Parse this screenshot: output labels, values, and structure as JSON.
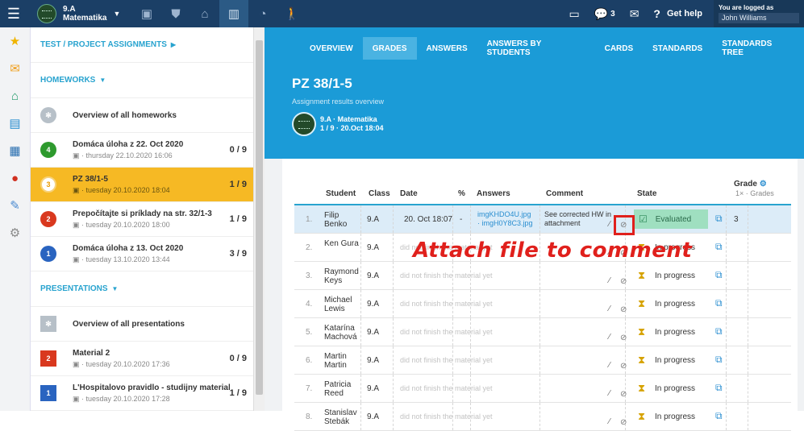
{
  "topbar": {
    "class_name": "9.A",
    "class_subject": "Matematika",
    "notifications_count": "3",
    "help_label": "Get help",
    "logged_as_label": "You are logged as",
    "user_name": "John Williams"
  },
  "left": {
    "assignments_title": "TEST / PROJECT ASSIGNMENTS",
    "homeworks_title": "HOMEWORKS",
    "homeworks": [
      {
        "badge": "",
        "title": "Overview of all homeworks",
        "sub": "",
        "score": ""
      },
      {
        "badge": "4",
        "title": "Domáca úloha z 22. Oct 2020",
        "sub": "thursday 22.10.2020 16:06",
        "score": "0 / 9"
      },
      {
        "badge": "3",
        "title": "PZ 38/1-5",
        "sub": "tuesday 20.10.2020 18:04",
        "score": "1 / 9"
      },
      {
        "badge": "2",
        "title": "Prepočítajte si príklady na str. 32/1-3",
        "sub": "tuesday 20.10.2020 18:00",
        "score": "1 / 9"
      },
      {
        "badge": "1",
        "title": "Domáca úloha z 13. Oct 2020",
        "sub": "tuesday 13.10.2020 13:44",
        "score": "3 / 9"
      }
    ],
    "presentations_title": "PRESENTATIONS",
    "presentations": [
      {
        "badge": "",
        "title": "Overview of all presentations",
        "sub": "",
        "score": ""
      },
      {
        "badge": "2",
        "title": "Material 2",
        "sub": "tuesday 20.10.2020 17:36",
        "score": "0 / 9"
      },
      {
        "badge": "1",
        "title": "L'Hospitalovo pravidlo - studijny material",
        "sub": "tuesday 20.10.2020 17:28",
        "score": "1 / 9"
      }
    ]
  },
  "tabs": [
    "OVERVIEW",
    "GRADES",
    "ANSWERS",
    "ANSWERS BY STUDENTS",
    "CARDS",
    "STANDARDS",
    "STANDARDS TREE"
  ],
  "assignment": {
    "title": "PZ 38/1-5",
    "subtitle": "Assignment results overview",
    "class_line": "9.A · Matematika",
    "meta_line": "1 / 9 · 20.Oct 18:04"
  },
  "table": {
    "headers": {
      "student": "Student",
      "class": "Class",
      "date": "Date",
      "pct": "%",
      "answers": "Answers",
      "comment": "Comment",
      "state": "State",
      "grade": "Grade",
      "grade_sub": "1× · Grades"
    },
    "not_finished_text": "did not finish the material yet",
    "rows": [
      {
        "num": "1.",
        "student": "Filip Benko",
        "class": "9.A",
        "date": "20. Oct 18:07",
        "pct": "-",
        "answer1": "imgKHDO4U.jpg",
        "answer2": "· imgH0Y8C3.jpg",
        "comment": "See corrected HW in attachment",
        "state": "Evaluated",
        "grade": "3"
      },
      {
        "num": "2.",
        "student": "Ken Gura",
        "class": "9.A",
        "state": "In progress"
      },
      {
        "num": "3.",
        "student": "Raymond Keys",
        "class": "9.A",
        "state": "In progress"
      },
      {
        "num": "4.",
        "student": "Michael Lewis",
        "class": "9.A",
        "state": "In progress"
      },
      {
        "num": "5.",
        "student": "Katarína Machová",
        "class": "9.A",
        "state": "In progress"
      },
      {
        "num": "6.",
        "student": "Martin Martin",
        "class": "9.A",
        "state": "In progress"
      },
      {
        "num": "7.",
        "student": "Patricia Reed",
        "class": "9.A",
        "state": "In progress"
      },
      {
        "num": "8.",
        "student": "Stanislav Stebák",
        "class": "9.A",
        "state": "In progress"
      }
    ]
  },
  "annotation": "Attach file to comment",
  "colors": {
    "topbar": "#1b3f66",
    "hero": "#1b9bd7",
    "active_item": "#f6b924",
    "annotation": "#e0201c",
    "evaluated": "#9fdfc0"
  }
}
